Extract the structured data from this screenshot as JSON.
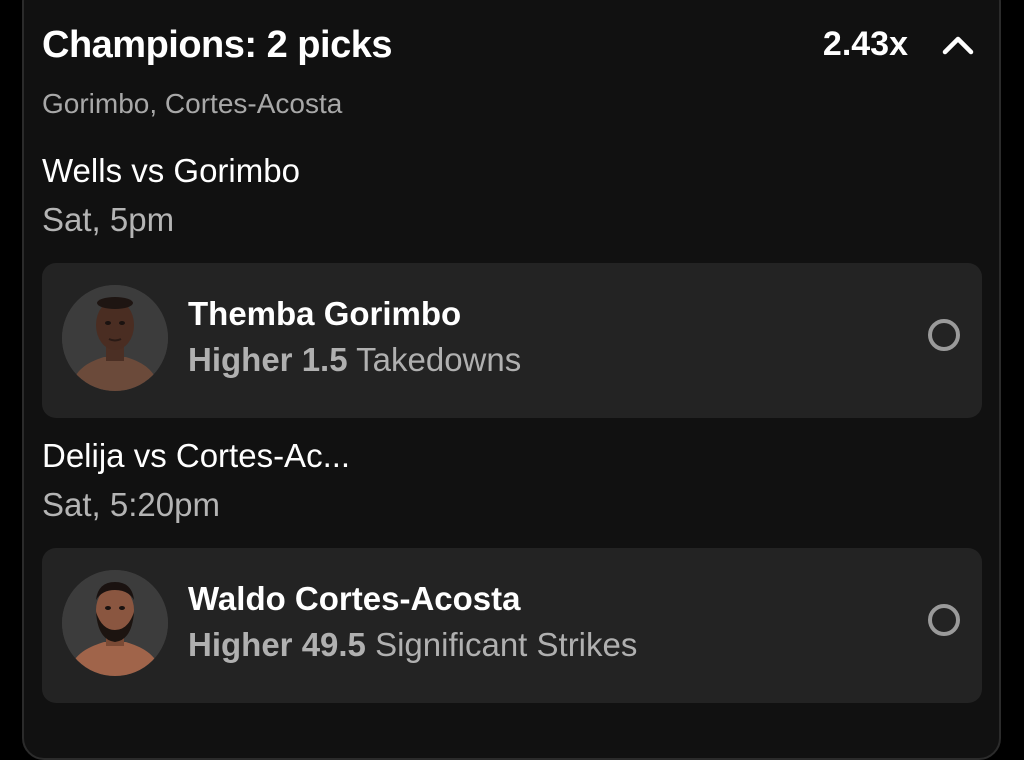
{
  "header": {
    "title": "Champions: 2 picks",
    "multiplier": "2.43x",
    "subtitle": "Gorimbo, Cortes-Acosta",
    "toggle_icon": "chevron-up-icon"
  },
  "matches": [
    {
      "title": "Wells vs Gorimbo",
      "time": "Sat, 5pm",
      "pick": {
        "player": "Themba Gorimbo",
        "direction": "Higher",
        "line": "1.5",
        "stat": "Takedowns",
        "avatar_icon": "player-avatar",
        "radio_icon": "radio-unselected-icon"
      }
    },
    {
      "title": "Delija vs Cortes-Ac...",
      "time": "Sat, 5:20pm",
      "pick": {
        "player": "Waldo Cortes-Acosta",
        "direction": "Higher",
        "line": "49.5",
        "stat": "Significant Strikes",
        "avatar_icon": "player-avatar",
        "radio_icon": "radio-unselected-icon"
      }
    }
  ],
  "colors": {
    "background": "#000000",
    "panel": "#111111",
    "card": "#232323",
    "primary_text": "#ffffff",
    "secondary_text": "#a8a8a8"
  }
}
